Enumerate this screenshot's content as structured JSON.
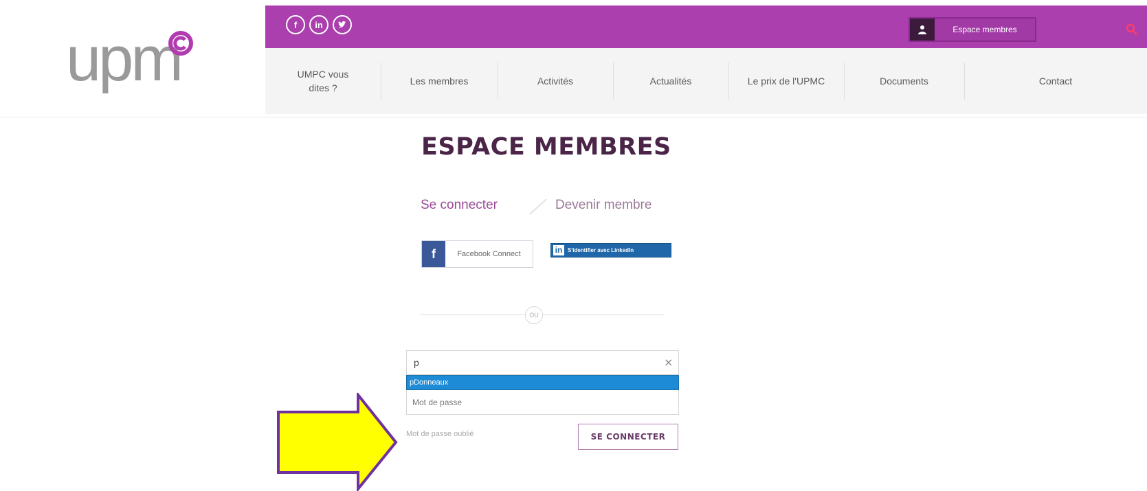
{
  "logo": {
    "text": "upm"
  },
  "social": [
    "f",
    "in",
    "t"
  ],
  "top_bar": {
    "member_button_label": "Espace membres"
  },
  "nav": {
    "items": [
      "UMPC vous\ndites ?",
      "Les membres",
      "Activités",
      "Actualités",
      "Le prix de l'UPMC",
      "Documents",
      "Contact"
    ]
  },
  "page": {
    "title": "ESPACE MEMBRES",
    "tabs": {
      "active": "Se connecter",
      "inactive": "Devenir membre"
    },
    "facebook_button": {
      "letter": "f",
      "label": "Facebook Connect"
    },
    "linkedin_button": {
      "label": "S'identifier avec LinkedIn"
    },
    "separator": "OU",
    "login_field": {
      "value": "p",
      "clear_symbol": "×"
    },
    "autocomplete": [
      "pDonneaux"
    ],
    "password_placeholder": "Mot de passe",
    "forgot_link": "Mot de passe oublié",
    "submit_label": "SE CONNECTER"
  },
  "colors": {
    "brand_purple": "#aa3fad",
    "title": "#4a2548",
    "annotation_arrow_fill": "#ffff00",
    "annotation_arrow_stroke": "#7030a0"
  }
}
